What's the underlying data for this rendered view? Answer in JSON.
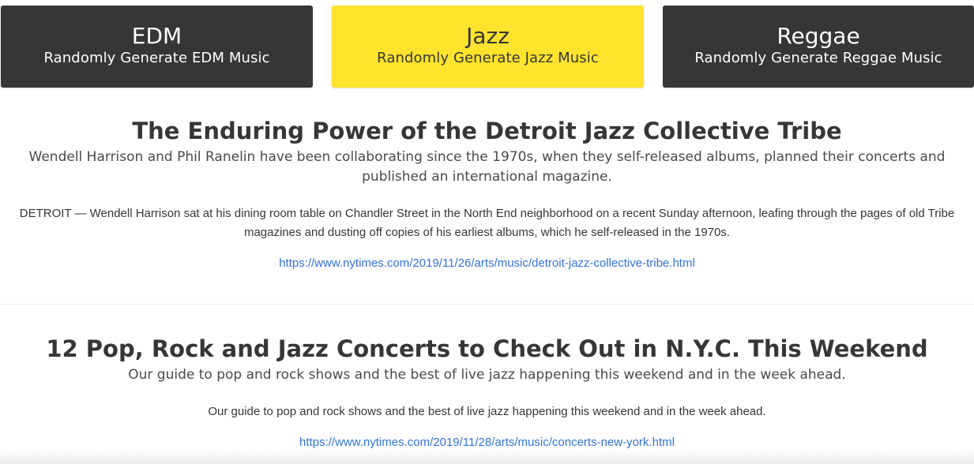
{
  "genres": [
    {
      "title": "EDM",
      "subtitle": "Randomly Generate EDM Music",
      "active": false
    },
    {
      "title": "Jazz",
      "subtitle": "Randomly Generate Jazz Music",
      "active": true
    },
    {
      "title": "Reggae",
      "subtitle": "Randomly Generate Reggae Music",
      "active": false
    }
  ],
  "articles": [
    {
      "title": "The Enduring Power of the Detroit Jazz Collective Tribe",
      "subtitle": "Wendell Harrison and Phil Ranelin have been collaborating since the 1970s, when they self-released albums, planned their concerts and published an international magazine.",
      "body": "DETROIT — Wendell Harrison sat at his dining room table on Chandler Street in the North End neighborhood on a recent Sunday afternoon, leafing through the pages of old Tribe magazines and dusting off copies of his earliest albums, which he self-released in the 1970s.",
      "link": "https://www.nytimes.com/2019/11/26/arts/music/detroit-jazz-collective-tribe.html"
    },
    {
      "title": "12 Pop, Rock and Jazz Concerts to Check Out in N.Y.C. This Weekend",
      "subtitle": "Our guide to pop and rock shows and the best of live jazz happening this weekend and in the week ahead.",
      "body": "Our guide to pop and rock shows and the best of live jazz happening this weekend and in the week ahead.",
      "link": "https://www.nytimes.com/2019/11/28/arts/music/concerts-new-york.html"
    }
  ],
  "colors": {
    "dark_card": "#363636",
    "active_card": "#ffe32d",
    "link": "#3273dc"
  }
}
